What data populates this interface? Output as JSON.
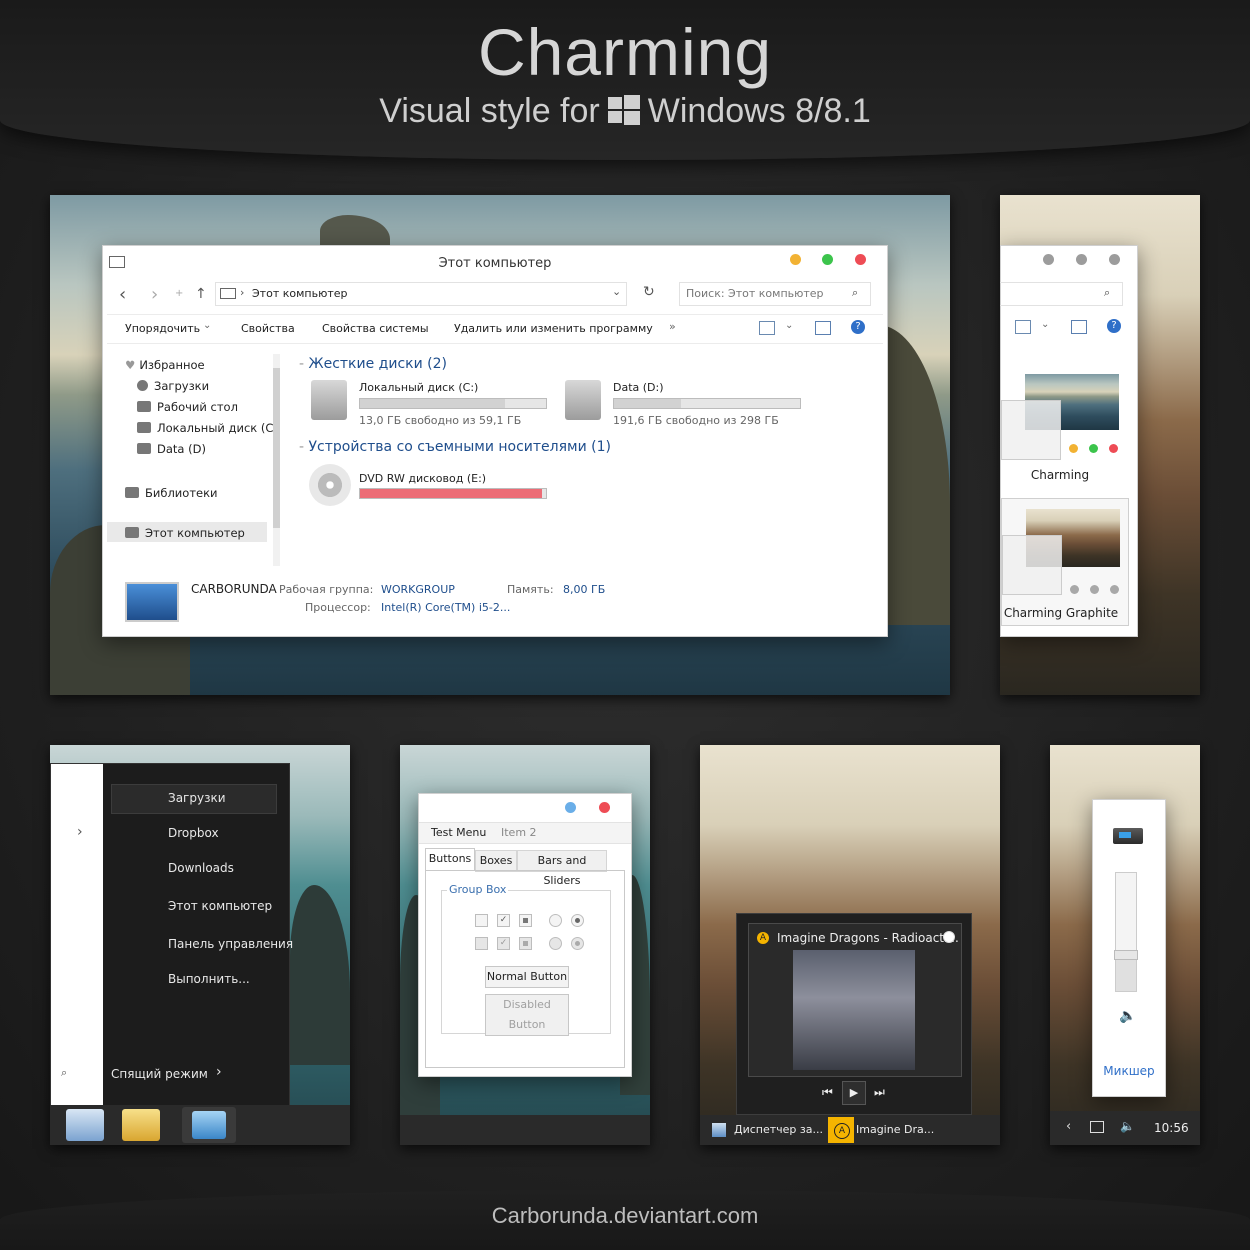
{
  "header": {
    "title": "Charming",
    "subtitle_left": "Visual style for",
    "subtitle_right": "Windows 8/8.1"
  },
  "footer": {
    "credit": "Carborunda.deviantart.com"
  },
  "explorer": {
    "window_title": "Этот компьютер",
    "address": "Этот компьютер",
    "search_placeholder": "Поиск: Этот компьютер",
    "ribbon": [
      "Упорядочить",
      "Свойства",
      "Свойства системы",
      "Удалить или изменить программу",
      "»"
    ],
    "nav": {
      "favorites": "Избранное",
      "favorites_items": [
        "Загрузки",
        "Рабочий стол",
        "Локальный диск (C)",
        "Data (D)"
      ],
      "libraries": "Библиотеки",
      "this_pc": "Этот компьютер"
    },
    "groups": {
      "hard_drives": "Жесткие диски (2)",
      "removable": "Устройства со съемными носителями (1)"
    },
    "drives": [
      {
        "name": "Локальный диск (C:)",
        "free": "13,0 ГБ свободно из 59,1 ГБ",
        "used_fraction": 0.78
      },
      {
        "name": "Data (D:)",
        "free": "191,6 ГБ свободно из 298 ГБ",
        "used_fraction": 0.36
      }
    ],
    "dvd": {
      "name": "DVD RW дисковод (E:)",
      "used_fraction": 0.98
    },
    "details": {
      "pc_name": "CARBORUNDA",
      "workgroup_label": "Рабочая группа:",
      "workgroup": "WORKGROUP",
      "memory_label": "Память:",
      "memory": "8,00 ГБ",
      "cpu_label": "Процессор:",
      "cpu": "Intel(R) Core(TM) i5-2..."
    },
    "traffic_colors": [
      "#f2b233",
      "#3cc44c",
      "#ee4c55"
    ]
  },
  "theme_picker": {
    "themes": [
      {
        "name": "Charming",
        "dot_colors": [
          "#f2b233",
          "#3cc44c",
          "#ee4c55"
        ]
      },
      {
        "name": "Charming Graphite",
        "dot_colors": [
          "#a8a8a8",
          "#a8a8a8",
          "#a8a8a8"
        ]
      }
    ]
  },
  "start_menu": {
    "items": [
      "Загрузки",
      "Dropbox",
      "Downloads",
      "Этот компьютер",
      "Панель управления",
      "Выполнить..."
    ],
    "sleep": "Спящий режим",
    "arrow": "›"
  },
  "test_dialog": {
    "menu": [
      "Test Menu",
      "Item 2"
    ],
    "tabs": [
      "Buttons",
      "Boxes",
      "Bars and Sliders"
    ],
    "group_box": "Group Box",
    "normal_button": "Normal Button",
    "disabled_button": "Disabled Button"
  },
  "media": {
    "track": "Imagine Dragons - Radioacti...",
    "taskbar": [
      "Диспетчер за...",
      "Imagine Dra..."
    ]
  },
  "volume": {
    "mixer": "Микшер",
    "clock": "10:56",
    "level_fraction": 0.3
  }
}
